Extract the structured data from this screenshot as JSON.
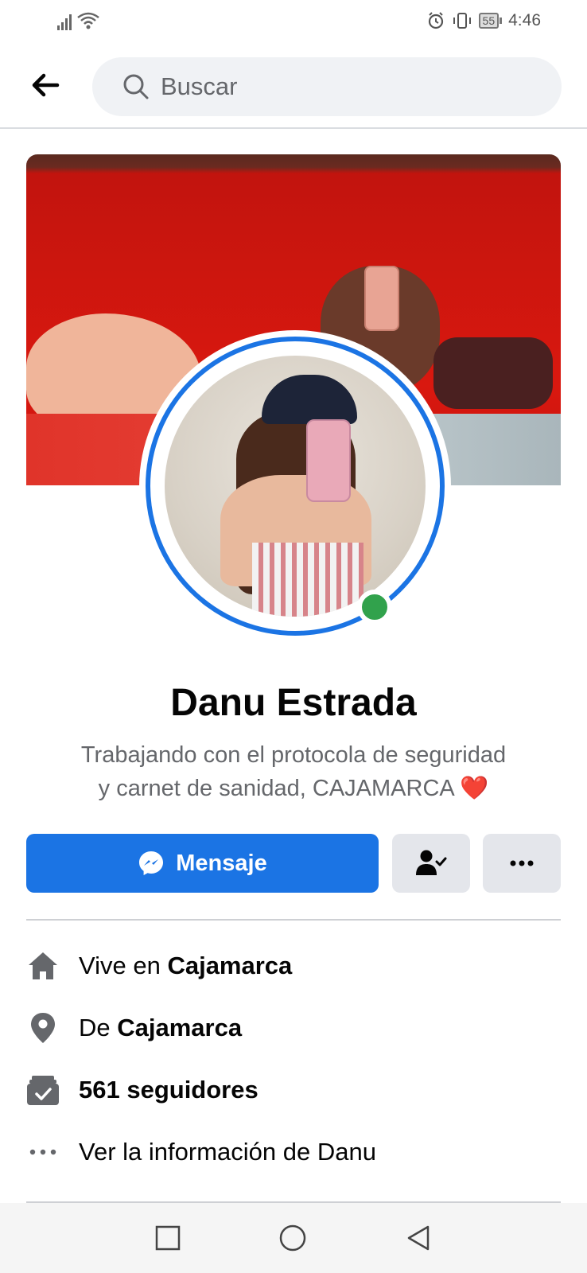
{
  "status_bar": {
    "time": "4:46",
    "battery_level": "55",
    "icons": [
      "signal-icon",
      "wifi-icon",
      "alarm-icon",
      "vibrate-icon",
      "battery-icon"
    ]
  },
  "header": {
    "back_icon": "arrow-left-icon",
    "search_placeholder": "Buscar",
    "search_icon": "search-icon"
  },
  "profile": {
    "name": "Danu Estrada",
    "bio_line1": "Trabajando con el protocola de seguridad",
    "bio_line2": "y carnet de sanidad, CAJAMARCA",
    "bio_emoji": "❤️",
    "online": true
  },
  "actions": {
    "message_label": "Mensaje",
    "message_icon": "messenger-icon",
    "friend_icon": "friends-check-icon",
    "more_icon": "more-horizontal-icon"
  },
  "details": {
    "lives_prefix": "Vive en ",
    "lives_place": "Cajamarca",
    "from_prefix": "De ",
    "from_place": "Cajamarca",
    "followers": "561 seguidores",
    "see_info": "Ver la información de Danu"
  },
  "colors": {
    "accent": "#1b74e4",
    "online": "#31a24c",
    "secondary_text": "#65676b",
    "button_gray": "#e4e6eb"
  },
  "nav": {
    "icons": [
      "recents-square-icon",
      "home-circle-icon",
      "back-triangle-icon"
    ]
  }
}
